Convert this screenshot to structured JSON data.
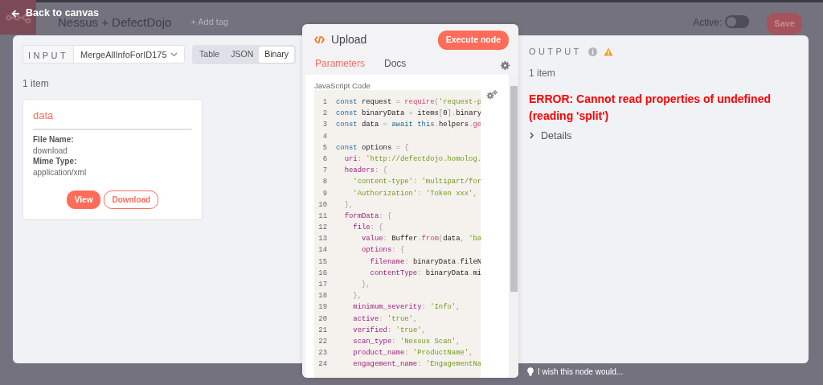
{
  "header": {
    "back_label": "Back to canvas",
    "workflow_name": "Nessus + DefectDojo",
    "add_tag": "+ Add tag",
    "active_label": "Active:",
    "active_on": false,
    "save": "Save"
  },
  "input": {
    "label": "INPUT",
    "node_select": "MergeAllInfoForID175",
    "views": [
      {
        "label": "Table",
        "selected": false
      },
      {
        "label": "JSON",
        "selected": false
      },
      {
        "label": "Binary",
        "selected": true
      }
    ],
    "count": "1 item",
    "binary_card": {
      "title": "data",
      "fields": [
        {
          "label": "File Name:",
          "value": "download"
        },
        {
          "label": "Mime Type:",
          "value": "application/xml"
        }
      ],
      "buttons": [
        {
          "label": "View",
          "kind": "primary"
        },
        {
          "label": "Download",
          "kind": "outline"
        }
      ]
    }
  },
  "node": {
    "title": "Upload",
    "execute": "Execute node",
    "tabs": [
      {
        "label": "Parameters",
        "selected": true
      },
      {
        "label": "Docs",
        "selected": false
      }
    ],
    "field_label": "JavaScript Code",
    "code": [
      {
        "number": "1",
        "tokens": [
          {
            "text": "const ",
            "kind": "kw"
          },
          {
            "text": "request ",
            "kind": "plain"
          },
          {
            "text": "= ",
            "kind": "op"
          },
          {
            "text": "require",
            "kind": "fn"
          },
          {
            "text": "(",
            "kind": "op"
          },
          {
            "text": "'request-p",
            "kind": "str"
          }
        ]
      },
      {
        "number": "2",
        "tokens": [
          {
            "text": "const ",
            "kind": "kw"
          },
          {
            "text": "binaryData ",
            "kind": "plain"
          },
          {
            "text": "= ",
            "kind": "op"
          },
          {
            "text": "items",
            "kind": "plain"
          },
          {
            "text": "[",
            "kind": "op"
          },
          {
            "text": "0",
            "kind": "plain"
          },
          {
            "text": "].",
            "kind": "op"
          },
          {
            "text": "binary",
            "kind": "plain"
          }
        ]
      },
      {
        "number": "3",
        "tokens": [
          {
            "text": "const ",
            "kind": "kw"
          },
          {
            "text": "data ",
            "kind": "plain"
          },
          {
            "text": "= ",
            "kind": "op"
          },
          {
            "text": "await ",
            "kind": "kw"
          },
          {
            "text": "this",
            "kind": "kw"
          },
          {
            "text": ".",
            "kind": "op"
          },
          {
            "text": "helpers",
            "kind": "plain"
          },
          {
            "text": ".",
            "kind": "op"
          },
          {
            "text": "ge",
            "kind": "fn"
          }
        ]
      },
      {
        "number": "4"
      },
      {
        "number": "5",
        "tokens": [
          {
            "text": "const ",
            "kind": "kw"
          },
          {
            "text": "options ",
            "kind": "plain"
          },
          {
            "text": "= {",
            "kind": "op"
          }
        ]
      },
      {
        "number": "6",
        "tokens": [
          {
            "text": "  uri",
            "kind": "prop"
          },
          {
            "text": ": ",
            "kind": "op"
          },
          {
            "text": "'http://defectdojo.homolog.",
            "kind": "str"
          }
        ]
      },
      {
        "number": "7",
        "tokens": [
          {
            "text": "  headers",
            "kind": "prop"
          },
          {
            "text": ": {",
            "kind": "op"
          }
        ]
      },
      {
        "number": "8",
        "tokens": [
          {
            "text": "    'content-type'",
            "kind": "str"
          },
          {
            "text": ": ",
            "kind": "op"
          },
          {
            "text": "'multipart/for",
            "kind": "str"
          }
        ]
      },
      {
        "number": "9",
        "tokens": [
          {
            "text": "    'Authorization'",
            "kind": "str"
          },
          {
            "text": ": ",
            "kind": "op"
          },
          {
            "text": "'Token xxx'",
            "kind": "str"
          },
          {
            "text": ",",
            "kind": "op"
          }
        ]
      },
      {
        "number": "10",
        "tokens": [
          {
            "text": "  },",
            "kind": "op"
          }
        ]
      },
      {
        "number": "11",
        "tokens": [
          {
            "text": "  formData",
            "kind": "prop"
          },
          {
            "text": ": {",
            "kind": "op"
          }
        ]
      },
      {
        "number": "12",
        "tokens": [
          {
            "text": "    file",
            "kind": "prop"
          },
          {
            "text": ": {",
            "kind": "op"
          }
        ]
      },
      {
        "number": "13",
        "tokens": [
          {
            "text": "      value",
            "kind": "prop"
          },
          {
            "text": ": ",
            "kind": "op"
          },
          {
            "text": "Buffer",
            "kind": "plain"
          },
          {
            "text": ".",
            "kind": "op"
          },
          {
            "text": "from",
            "kind": "fn"
          },
          {
            "text": "(",
            "kind": "op"
          },
          {
            "text": "data",
            "kind": "plain"
          },
          {
            "text": ", ",
            "kind": "op"
          },
          {
            "text": "'ba",
            "kind": "str"
          }
        ]
      },
      {
        "number": "14",
        "tokens": [
          {
            "text": "      options",
            "kind": "prop"
          },
          {
            "text": ": {",
            "kind": "op"
          }
        ]
      },
      {
        "number": "15",
        "tokens": [
          {
            "text": "        filename",
            "kind": "prop"
          },
          {
            "text": ": ",
            "kind": "op"
          },
          {
            "text": "binaryData",
            "kind": "plain"
          },
          {
            "text": ".",
            "kind": "op"
          },
          {
            "text": "fileN",
            "kind": "plain"
          }
        ]
      },
      {
        "number": "16",
        "tokens": [
          {
            "text": "        contentType",
            "kind": "prop"
          },
          {
            "text": ": ",
            "kind": "op"
          },
          {
            "text": "binaryData",
            "kind": "plain"
          },
          {
            "text": ".",
            "kind": "op"
          },
          {
            "text": "mi",
            "kind": "plain"
          }
        ]
      },
      {
        "number": "17",
        "tokens": [
          {
            "text": "      },",
            "kind": "op"
          }
        ]
      },
      {
        "number": "18",
        "tokens": [
          {
            "text": "    },",
            "kind": "op"
          }
        ]
      },
      {
        "number": "19",
        "tokens": [
          {
            "text": "    minimum_severity",
            "kind": "prop"
          },
          {
            "text": ": ",
            "kind": "op"
          },
          {
            "text": "'Info'",
            "kind": "str"
          },
          {
            "text": ",",
            "kind": "op"
          }
        ]
      },
      {
        "number": "20",
        "tokens": [
          {
            "text": "    active",
            "kind": "prop"
          },
          {
            "text": ": ",
            "kind": "op"
          },
          {
            "text": "'true'",
            "kind": "str"
          },
          {
            "text": ",",
            "kind": "op"
          }
        ]
      },
      {
        "number": "21",
        "tokens": [
          {
            "text": "    verified",
            "kind": "prop"
          },
          {
            "text": ": ",
            "kind": "op"
          },
          {
            "text": "'true'",
            "kind": "str"
          },
          {
            "text": ",",
            "kind": "op"
          }
        ]
      },
      {
        "number": "22",
        "tokens": [
          {
            "text": "    scan_type",
            "kind": "prop"
          },
          {
            "text": ": ",
            "kind": "op"
          },
          {
            "text": "'Nessus Scan'",
            "kind": "str"
          },
          {
            "text": ",",
            "kind": "op"
          }
        ]
      },
      {
        "number": "23",
        "tokens": [
          {
            "text": "    product_name",
            "kind": "prop"
          },
          {
            "text": ": ",
            "kind": "op"
          },
          {
            "text": "'ProductName'",
            "kind": "str"
          },
          {
            "text": ",",
            "kind": "op"
          }
        ]
      },
      {
        "number": "24",
        "tokens": [
          {
            "text": "    engagement_name",
            "kind": "prop"
          },
          {
            "text": ": ",
            "kind": "op"
          },
          {
            "text": "'EngagementNa",
            "kind": "str"
          }
        ]
      }
    ]
  },
  "output": {
    "label": "OUTPUT",
    "count": "1 item",
    "error": "ERROR: Cannot read properties of undefined (reading 'split')",
    "details": "Details",
    "details_expanded": false
  },
  "feedback": "I wish this node would..."
}
